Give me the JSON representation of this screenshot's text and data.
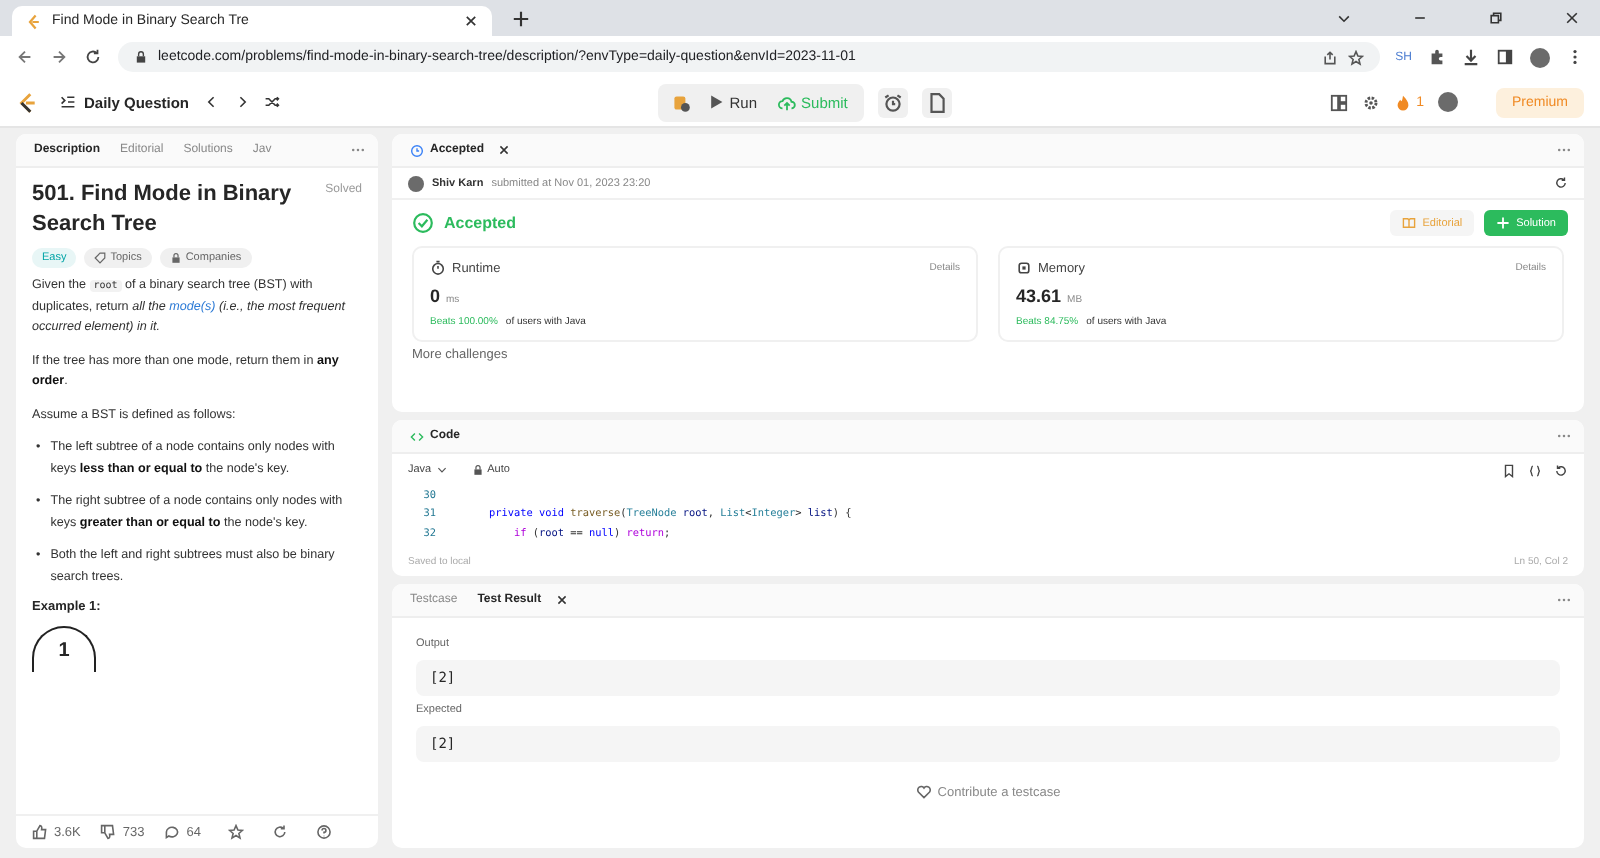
{
  "browser": {
    "tab_title": "Find Mode in Binary Search Tre",
    "url": "leetcode.com/problems/find-mode-in-binary-search-tree/description/?envType=daily-question&envId=2023-11-01",
    "extension_label": "SH"
  },
  "navbar": {
    "daily_label": "Daily Question",
    "run_label": "Run",
    "submit_label": "Submit",
    "streak": "1",
    "premium_label": "Premium"
  },
  "left_panel": {
    "tabs": [
      {
        "label": "Description",
        "selected": true
      },
      {
        "label": "Editorial",
        "selected": false
      },
      {
        "label": "Solutions",
        "selected": false
      },
      {
        "label": "Jav",
        "selected": false
      }
    ],
    "title": "501. Find Mode in Binary Search Tree",
    "status": "Solved",
    "tags": [
      {
        "kind": "difficulty",
        "label": "Easy"
      },
      {
        "kind": "topics",
        "label": "Topics"
      },
      {
        "kind": "companies",
        "label": "Companies"
      }
    ],
    "paragraphs": [
      [
        {
          "kind": "plain",
          "text": "Given the "
        },
        {
          "kind": "code",
          "text": "root"
        },
        {
          "kind": "plain",
          "text": " of a binary search tree (BST) with duplicates, return "
        },
        {
          "kind": "italic",
          "text": "all the "
        },
        {
          "kind": "link",
          "text": "mode(s)"
        },
        {
          "kind": "italic",
          "text": " (i.e., the most frequent occurred element) in it."
        }
      ],
      [
        {
          "kind": "plain",
          "text": "If the tree has more than one mode, return them in "
        },
        {
          "kind": "bold",
          "text": "any order"
        },
        {
          "kind": "plain",
          "text": "."
        }
      ],
      [
        {
          "kind": "plain",
          "text": "Assume a BST is defined as follows:"
        }
      ]
    ],
    "bullets": [
      {
        "marker": "•",
        "segments": [
          {
            "kind": "plain",
            "text": "The left subtree of a node contains only nodes with keys "
          },
          {
            "kind": "bold",
            "text": "less than or equal to"
          },
          {
            "kind": "plain",
            "text": " the node's key."
          }
        ]
      },
      {
        "marker": "•",
        "segments": [
          {
            "kind": "plain",
            "text": "The right subtree of a node contains only nodes with keys "
          },
          {
            "kind": "bold",
            "text": "greater than or equal to"
          },
          {
            "kind": "plain",
            "text": " the node's key."
          }
        ]
      },
      {
        "marker": "•",
        "segments": [
          {
            "kind": "plain",
            "text": "Both the left and right subtrees must also be binary search trees."
          }
        ]
      }
    ],
    "example_heading": "Example 1:",
    "example_node": "1",
    "stats": {
      "likes": "3.6K",
      "dislikes": "733",
      "comments": "64"
    }
  },
  "submission": {
    "tab_label": "Accepted",
    "author": "Shiv Karn",
    "submitted_text": "submitted at Nov 01, 2023 23:20",
    "status": "Accepted",
    "editorial_button": "Editorial",
    "solution_button": "Solution",
    "metrics": [
      {
        "kind": "runtime",
        "label": "Runtime",
        "details": "Details",
        "value": "0",
        "unit": "ms",
        "beats": "Beats 100.00%",
        "beats_suffix": "of users with Java"
      },
      {
        "kind": "memory",
        "label": "Memory",
        "details": "Details",
        "value": "43.61",
        "unit": "MB",
        "beats": "Beats 84.75%",
        "beats_suffix": "of users with Java"
      }
    ],
    "more": "More challenges"
  },
  "code": {
    "tab_label": "Code",
    "language": "Java",
    "mode": "Auto",
    "lines": [
      {
        "number": "30"
      },
      {
        "number": "31",
        "tokens": [
          {
            "kind": "keyword",
            "text": "    private"
          },
          {
            "kind": "keyword",
            "text": " void"
          },
          {
            "kind": "function",
            "text": " traverse"
          },
          {
            "kind": "plain",
            "text": "("
          },
          {
            "kind": "type",
            "text": "TreeNode"
          },
          {
            "kind": "variable",
            "text": " root"
          },
          {
            "kind": "plain",
            "text": ", "
          },
          {
            "kind": "type",
            "text": "List"
          },
          {
            "kind": "plain",
            "text": "<"
          },
          {
            "kind": "type",
            "text": "Integer"
          },
          {
            "kind": "plain",
            "text": "> "
          },
          {
            "kind": "variable",
            "text": "list"
          },
          {
            "kind": "plain",
            "text": ") {"
          }
        ]
      },
      {
        "number": "32",
        "tokens": [
          {
            "kind": "control",
            "text": "        if"
          },
          {
            "kind": "plain",
            "text": " ("
          },
          {
            "kind": "variable",
            "text": "root"
          },
          {
            "kind": "plain",
            "text": " == "
          },
          {
            "kind": "keyword",
            "text": "null"
          },
          {
            "kind": "plain",
            "text": ") "
          },
          {
            "kind": "control",
            "text": "return"
          },
          {
            "kind": "plain",
            "text": ";"
          }
        ]
      }
    ],
    "saved": "Saved to local",
    "cursor": "Ln 50, Col 2"
  },
  "tests": {
    "tabs": [
      {
        "label": "Testcase",
        "selected": false
      },
      {
        "label": "Test Result",
        "selected": true
      }
    ],
    "fields": [
      {
        "label": "Output",
        "value": "[2]"
      },
      {
        "label": "Expected",
        "value": "[2]"
      }
    ],
    "contribute": "Contribute a testcase"
  }
}
